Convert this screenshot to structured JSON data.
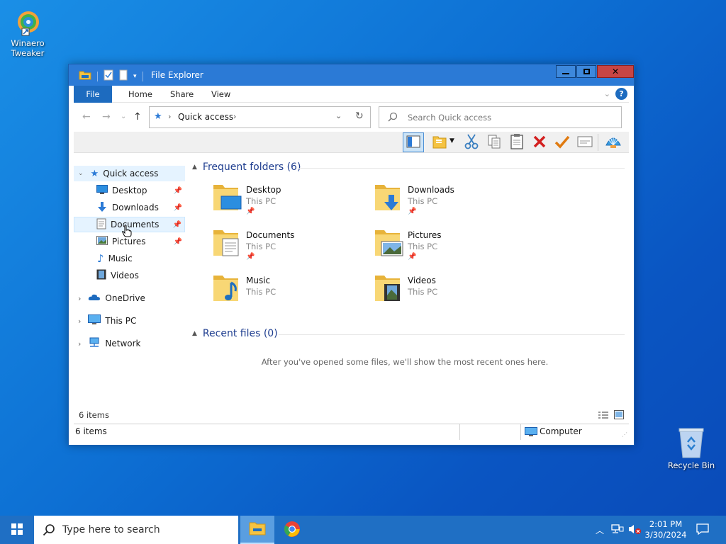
{
  "desktop": {
    "icons": [
      {
        "label_line1": "Winaero",
        "label_line2": "Tweaker"
      },
      {
        "label_line1": "Recycle Bin"
      }
    ]
  },
  "window": {
    "title": "File Explorer",
    "tabs": [
      "File",
      "Home",
      "Share",
      "View"
    ],
    "address": {
      "location": "Quick access"
    },
    "search_placeholder": "Search Quick access",
    "nav": {
      "quick_access": "Quick access",
      "items": [
        "Desktop",
        "Downloads",
        "Documents",
        "Pictures",
        "Music",
        "Videos"
      ],
      "onedrive": "OneDrive",
      "this_pc": "This PC",
      "network": "Network"
    },
    "frequent_header": "Frequent folders (6)",
    "folders": [
      {
        "name": "Desktop",
        "location": "This PC"
      },
      {
        "name": "Downloads",
        "location": "This PC"
      },
      {
        "name": "Documents",
        "location": "This PC"
      },
      {
        "name": "Pictures",
        "location": "This PC"
      },
      {
        "name": "Music",
        "location": "This PC"
      },
      {
        "name": "Videos",
        "location": "This PC"
      }
    ],
    "recent_header": "Recent files (0)",
    "recent_empty": "After you've opened some files, we'll show the most recent ones here.",
    "item_count": "6 items",
    "status_count": "6 items",
    "status_location": "Computer"
  },
  "taskbar": {
    "search_placeholder": "Type here to search",
    "time": "2:01 PM",
    "date": "3/30/2024"
  },
  "colors": {
    "accent": "#1d6bbf",
    "titlebar": "#2b7ad6",
    "taskbar": "#1f6fc4",
    "folder": "#f5c342",
    "delete_red": "#d32020",
    "check_orange": "#e07a10"
  }
}
